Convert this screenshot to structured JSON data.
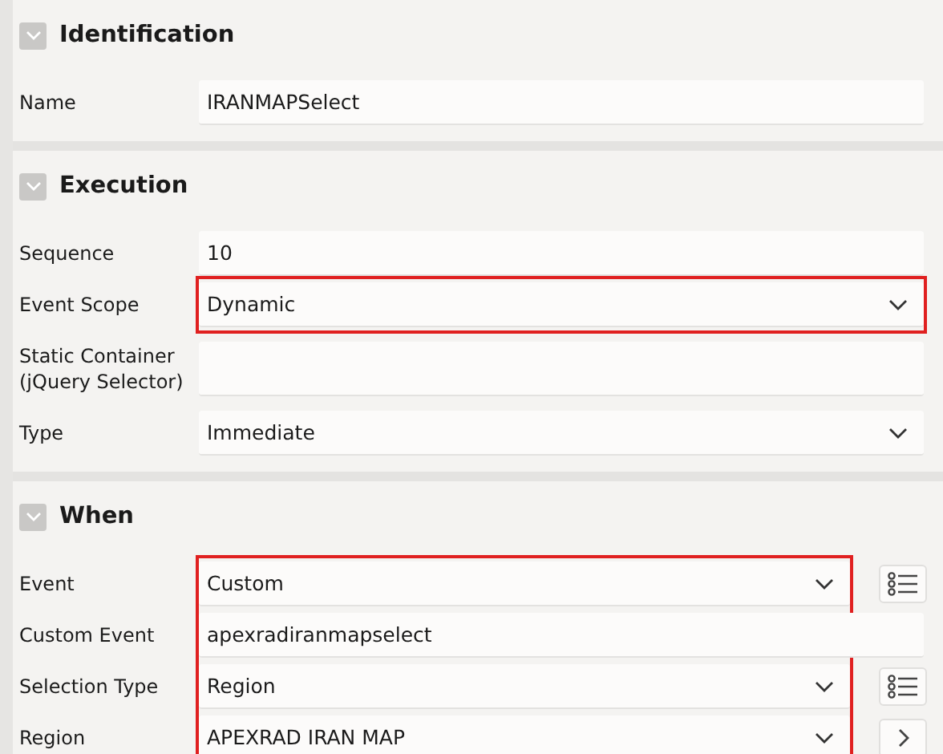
{
  "sections": [
    {
      "title": "Identification",
      "expanded": true,
      "rows": [
        {
          "label": "Name",
          "value": "IRANMAPSelect",
          "kind": "text",
          "highlighted": false
        }
      ]
    },
    {
      "title": "Execution",
      "expanded": true,
      "rows": [
        {
          "label": "Sequence",
          "value": "10",
          "kind": "text",
          "highlighted": false
        },
        {
          "label": "Event Scope",
          "value": "Dynamic",
          "kind": "select",
          "highlighted": true
        },
        {
          "label": "Static Container (jQuery Selector)",
          "kind": "text",
          "highlighted": false
        },
        {
          "label": "Type",
          "value": "Immediate",
          "kind": "select",
          "highlighted": false
        }
      ]
    },
    {
      "title": "When",
      "expanded": true,
      "rows": [
        {
          "label": "Event",
          "value": "Custom",
          "kind": "select",
          "highlighted": true,
          "button": {
            "kind": "list"
          }
        },
        {
          "label": "Custom Event",
          "value": "apexradiranmapselect",
          "kind": "text",
          "highlighted": true
        },
        {
          "label": "Selection Type",
          "value": "Region",
          "kind": "select",
          "highlighted": true,
          "button": {
            "kind": "list"
          }
        },
        {
          "label": "Region",
          "value": "APEXRAD IRAN MAP",
          "kind": "select",
          "highlighted": true,
          "button": {
            "kind": "next"
          }
        }
      ]
    }
  ]
}
